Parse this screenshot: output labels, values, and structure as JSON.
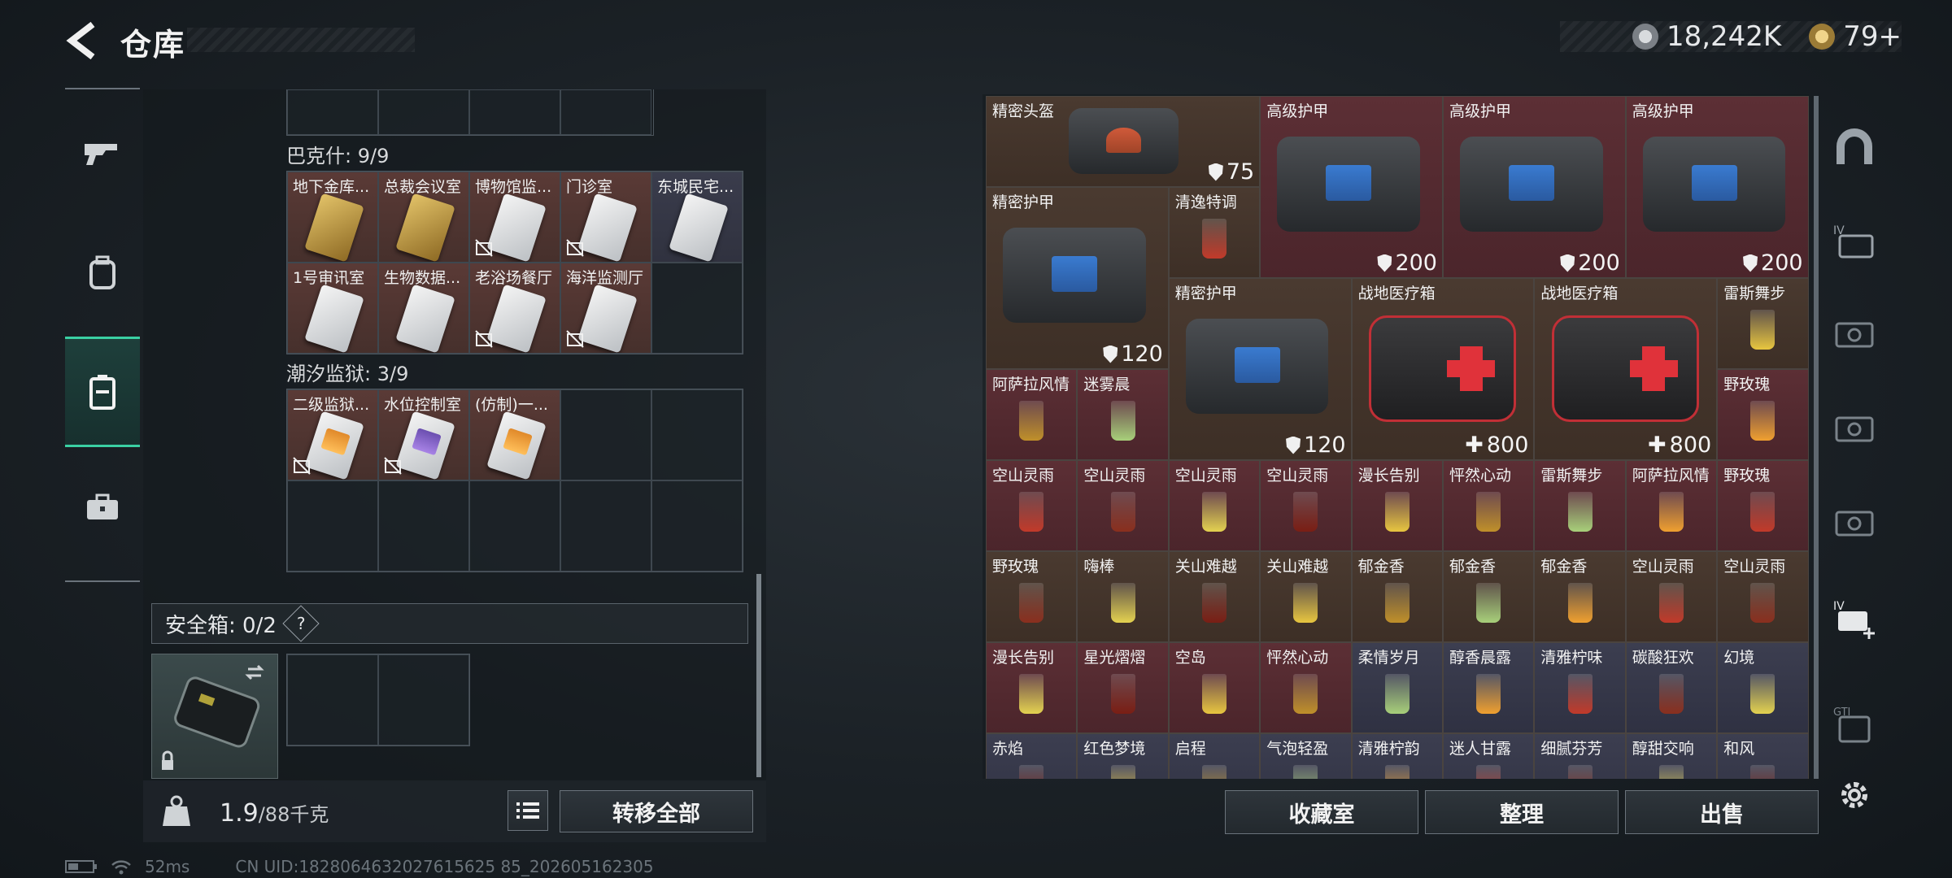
{
  "header": {
    "title": "仓库",
    "currency": [
      {
        "icon": "silver-coin-icon",
        "value": "18,242K"
      },
      {
        "icon": "gold-coin-icon",
        "value": "79+"
      }
    ]
  },
  "left_nav": [
    {
      "icon": "gun-icon"
    },
    {
      "icon": "backpack-icon"
    },
    {
      "icon": "locker-icon",
      "active": true
    },
    {
      "icon": "toolbox-icon"
    }
  ],
  "keycards": {
    "bakshi": {
      "label": "巴克什: 9/9",
      "items": [
        {
          "name": "地下金库...",
          "style": "gold"
        },
        {
          "name": "总裁会议室",
          "style": "gold"
        },
        {
          "name": "博物馆监...",
          "style": "silver",
          "nonsec": true
        },
        {
          "name": "门诊室",
          "style": "silver",
          "nonsec": true
        },
        {
          "name": "东城民宅...",
          "style": "silver"
        },
        {
          "name": "1号审讯室",
          "style": "silver"
        },
        {
          "name": "生物数据...",
          "style": "silver"
        },
        {
          "name": "老浴场餐厅",
          "style": "silver",
          "nonsec": true
        },
        {
          "name": "海洋监测厅",
          "style": "silver",
          "nonsec": true
        }
      ]
    },
    "tide_prison": {
      "label": "潮汐监狱: 3/9",
      "items": [
        {
          "name": "二级监狱...",
          "style": "orange",
          "nonsec": true
        },
        {
          "name": "水位控制室",
          "style": "purple",
          "nonsec": true
        },
        {
          "name": "(仿制)一...",
          "style": "orange"
        }
      ]
    }
  },
  "safebox": {
    "label": "安全箱: 0/2",
    "help": "?"
  },
  "weight": {
    "current": "1.9",
    "max": "/88千克"
  },
  "transfer_all": "转移全部",
  "status": {
    "ping": "52ms",
    "uid": "CN UID:1828064632027615625 85_202605162305"
  },
  "inventory": [
    {
      "name": "精密头盔",
      "value": "75",
      "kind": "shield"
    },
    {
      "name": "高级护甲",
      "value": "200",
      "kind": "shield"
    },
    {
      "name": "高级护甲",
      "value": "200",
      "kind": "shield"
    },
    {
      "name": "高级护甲",
      "value": "200",
      "kind": "shield"
    },
    {
      "name": "精密护甲",
      "value": "120",
      "kind": "shield"
    },
    {
      "name": "清逸特调"
    },
    {
      "name": "精密护甲",
      "value": "120",
      "kind": "shield"
    },
    {
      "name": "战地医疗箱",
      "value": "800",
      "kind": "heal"
    },
    {
      "name": "战地医疗箱",
      "value": "800",
      "kind": "heal"
    },
    {
      "name": "雷斯舞步"
    },
    {
      "name": "阿萨拉风情"
    },
    {
      "name": "迷雾晨"
    },
    {
      "name": "野玫瑰"
    },
    {
      "name": "空山灵雨"
    },
    {
      "name": "空山灵雨"
    },
    {
      "name": "空山灵雨"
    },
    {
      "name": "空山灵雨"
    },
    {
      "name": "漫长告别"
    },
    {
      "name": "怦然心动"
    },
    {
      "name": "雷斯舞步"
    },
    {
      "name": "阿萨拉风情"
    },
    {
      "name": "野玫瑰"
    },
    {
      "name": "野玫瑰"
    },
    {
      "name": "嗨棒"
    },
    {
      "name": "关山难越"
    },
    {
      "name": "关山难越"
    },
    {
      "name": "郁金香"
    },
    {
      "name": "郁金香"
    },
    {
      "name": "郁金香"
    },
    {
      "name": "空山灵雨"
    },
    {
      "name": "空山灵雨"
    },
    {
      "name": "漫长告别"
    },
    {
      "name": "星光熠熠"
    },
    {
      "name": "空岛"
    },
    {
      "name": "怦然心动"
    },
    {
      "name": "柔情岁月"
    },
    {
      "name": "醇香晨露"
    },
    {
      "name": "清雅柠味"
    },
    {
      "name": "碳酸狂欢"
    },
    {
      "name": "幻境"
    },
    {
      "name": "赤焰"
    },
    {
      "name": "红色梦境"
    },
    {
      "name": "启程"
    },
    {
      "name": "气泡轻盈"
    },
    {
      "name": "清雅柠韵"
    },
    {
      "name": "迷人甘露"
    },
    {
      "name": "细腻芬芳"
    },
    {
      "name": "醇甜交响"
    },
    {
      "name": "和风"
    }
  ],
  "right_buttons": {
    "collection": "收藏室",
    "sort": "整理",
    "sell": "出售"
  },
  "right_nav": [
    {
      "icon": "arch-icon"
    },
    {
      "icon": "iv-case-icon"
    },
    {
      "icon": "iv-case-icon"
    },
    {
      "icon": "iv-case-icon"
    },
    {
      "icon": "iv-case-icon"
    },
    {
      "icon": "add-case-icon"
    },
    {
      "icon": "gti-icon"
    },
    {
      "icon": "gear-icon"
    }
  ],
  "colors": {
    "accent": "#3ad0a3",
    "brown_cell": "#4a3a30",
    "red_cell": "#5c2f35",
    "blue_cell": "#3c3e50"
  }
}
